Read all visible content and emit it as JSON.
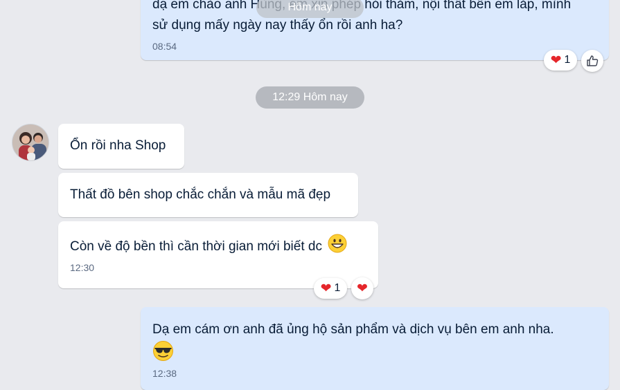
{
  "overlay_date_label": "Hôm nay",
  "date_separator": "12:29 Hôm nay",
  "messages": [
    {
      "id": "out1",
      "text_line1": "dạ em chào anh Hùng, em xin phép hỏi thăm, nội thất bên em lắp, mình",
      "text_line2": "sử dụng mấy ngày nay thấy ổn rồi anh ha?",
      "time": "08:54",
      "reaction_count": "1"
    },
    {
      "id": "in1",
      "text": "Ổn rồi nha Shop"
    },
    {
      "id": "in2",
      "text": "Thất đồ bên shop chắc chắn và mẫu mã đẹp"
    },
    {
      "id": "in3",
      "text": "Còn về độ bền thì cần thời gian mới biết dc",
      "emoji": "grinning-face",
      "time": "12:30",
      "reaction_count": "1"
    },
    {
      "id": "out2",
      "text": "Dạ em cám ơn anh đã ủng hộ sản phẩm và dịch vụ bên em anh nha.",
      "emoji": "sunglasses-face",
      "time": "12:38"
    }
  ],
  "reaction_icons": {
    "heart": "heart-icon",
    "like": "thumbs-up-icon"
  },
  "colors": {
    "background": "#e9eaee",
    "incoming_bubble": "#ffffff",
    "outgoing_bubble": "#dbe9fd",
    "heart": "#e5262b"
  }
}
